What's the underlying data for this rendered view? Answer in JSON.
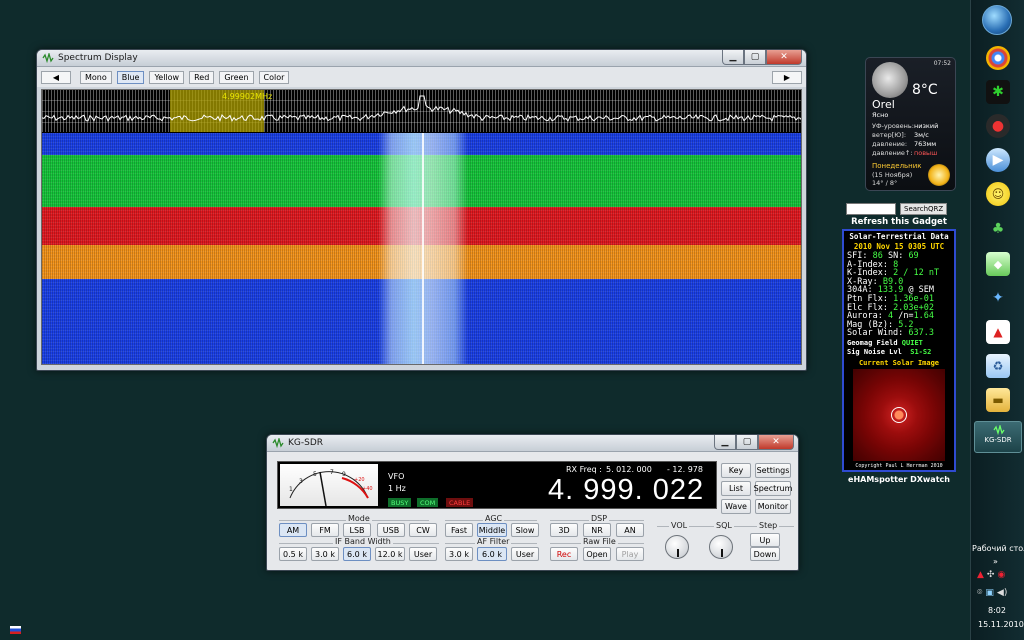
{
  "spectrum_window": {
    "title": "Spectrum Display",
    "toolbar": {
      "left_arrow": "◀",
      "right_arrow": "▶",
      "color_buttons": [
        "Mono",
        "Blue",
        "Yellow",
        "Red",
        "Green",
        "Color"
      ],
      "active": "Blue"
    },
    "marker_freq": "4.99902MHz",
    "window_buttons": {
      "minimize": "▁",
      "maximize": "▢",
      "close": "✕"
    }
  },
  "sdr_window": {
    "title": "KG-SDR",
    "vfo": "VFO",
    "step": "1 Hz",
    "indicators": {
      "busy": "BUSY",
      "com": "COM",
      "cable": "CABLE"
    },
    "rx_freq_label": "RX Freq :",
    "rx_freq_value": "5. 012. 000",
    "rx_offset": "- 12. 978",
    "main_freq": "4. 999. 022",
    "meter_scale": [
      "1",
      "3",
      "5",
      "7",
      "9",
      "+20",
      "+40"
    ],
    "side_buttons": {
      "key": "Key",
      "settings": "Settings",
      "list": "List",
      "spectrum": "Spectrum",
      "wave": "Wave",
      "monitor": "Monitor"
    },
    "mode": {
      "label": "Mode",
      "buttons": [
        "AM",
        "FM",
        "LSB",
        "USB",
        "CW"
      ],
      "active": "AM"
    },
    "if_bandwidth": {
      "label": "IF Band Width",
      "buttons": [
        "0.5 k",
        "3.0 k",
        "6.0 k",
        "12.0 k",
        "User"
      ],
      "active": "6.0 k"
    },
    "agc": {
      "label": "AGC",
      "buttons": [
        "Fast",
        "Middle",
        "Slow"
      ],
      "active": "Middle"
    },
    "af_filter": {
      "label": "AF Filter",
      "buttons": [
        "3.0 k",
        "6.0 k",
        "User"
      ],
      "active": "6.0 k"
    },
    "dsp": {
      "label": "DSP",
      "buttons": [
        "3D",
        "NR",
        "AN"
      ]
    },
    "raw_file": {
      "label": "Raw File",
      "rec": "Rec",
      "open": "Open",
      "play": "Play"
    },
    "vol_label": "VOL",
    "sql_label": "SQL",
    "step_group": {
      "label": "Step",
      "up": "Up",
      "down": "Down"
    },
    "window_buttons": {
      "minimize": "▁",
      "maximize": "▢",
      "close": "✕"
    }
  },
  "weather": {
    "time": "07:52",
    "temp": "8°C",
    "city": "Orel",
    "condition": "Ясно",
    "rows": [
      {
        "k": "УФ-уровень:",
        "v": "низкий",
        "red": false
      },
      {
        "k": "ветер[Ю]:",
        "v": "3м/с",
        "red": false
      },
      {
        "k": "давление:",
        "v": "763мм",
        "red": false
      },
      {
        "k": "давление↑:",
        "v": "повыш",
        "red": true
      }
    ],
    "day": "Понедельник",
    "date": "(15 Ноября)",
    "range": "14° / 8°"
  },
  "solar": {
    "search_button": "SearchQRZ",
    "refresh": "Refresh this Gadget",
    "title": "Solar-Terrestrial Data",
    "date": "2010 Nov 15 0305 UTC",
    "lines": [
      {
        "label": "SFI:   ",
        "value": "86",
        "label2": " SN:  ",
        "value2": "69"
      },
      {
        "label": "A-Index: ",
        "value": "8",
        "label2": "",
        "value2": ""
      },
      {
        "label": "K-Index: ",
        "value": "2 / 12 nT",
        "label2": "",
        "value2": ""
      },
      {
        "label": "X-Ray: ",
        "value": "B9.0",
        "label2": "",
        "value2": ""
      },
      {
        "label": "304A: ",
        "value": "133.9",
        "label2": " @ SEM",
        "value2": ""
      },
      {
        "label": "Ptn Flx: ",
        "value": "1.36e-01",
        "label2": "",
        "value2": ""
      },
      {
        "label": "Elc Flx: ",
        "value": "2.03e+02",
        "label2": "",
        "value2": ""
      },
      {
        "label": "Aurora: ",
        "value": "4",
        "label2": " /n=",
        "value2": "1.64"
      },
      {
        "label": "Mag (Bz): ",
        "value": "5.2",
        "label2": "",
        "value2": ""
      },
      {
        "label": "Solar Wind: ",
        "value": "637.3",
        "label2": "",
        "value2": ""
      }
    ],
    "geomag_label": "Geomag Field",
    "geomag_value": "QUIET",
    "noise_label": "Sig Noise Lvl",
    "noise_value": "S1-S2",
    "image_title": "Current Solar Image",
    "copyright": "Copyright Paul L Herrman 2010",
    "footer": "eHAMspotter DXwatch"
  },
  "taskbar": {
    "active_app": "KG-SDR",
    "desktop_label": "Рабочий стол",
    "chevron": "»",
    "time": "8:02",
    "date": "15.11.2010"
  },
  "colors": {
    "desktop": "#0f2b2c",
    "band_blue": "#1a3fe6",
    "band_green": "#15c43a",
    "band_red": "#e0181f",
    "band_orange": "#f3931a"
  }
}
